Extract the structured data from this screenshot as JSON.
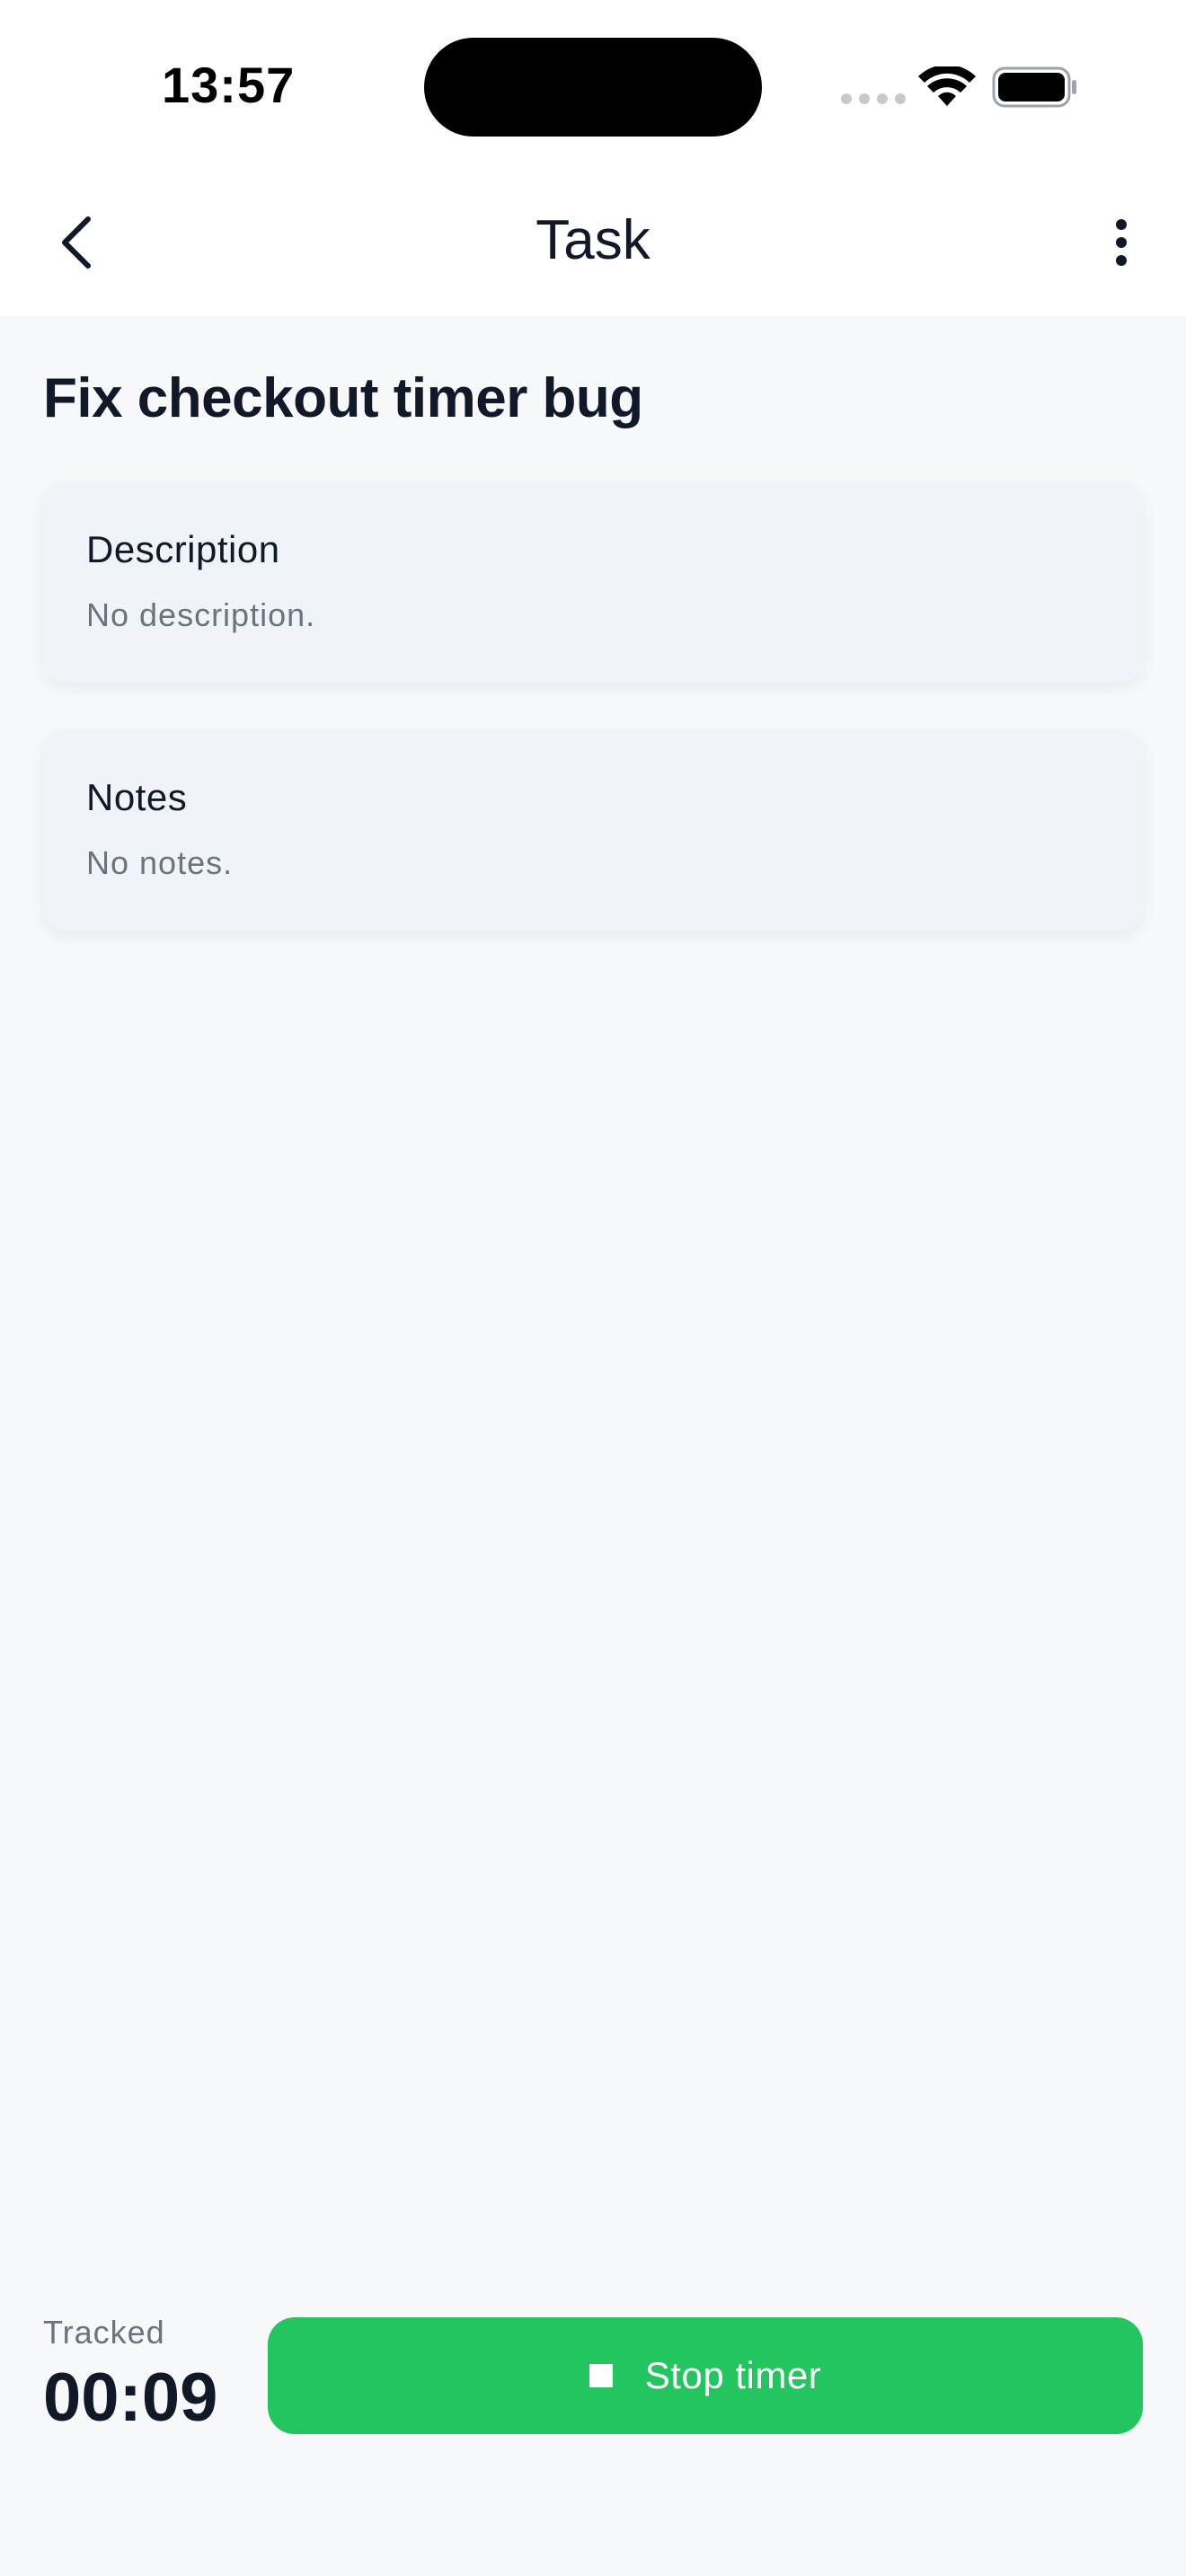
{
  "status_bar": {
    "time": "13:57"
  },
  "nav": {
    "title": "Task"
  },
  "task": {
    "title": "Fix checkout timer bug"
  },
  "cards": {
    "description": {
      "title": "Description",
      "body": "No description."
    },
    "notes": {
      "title": "Notes",
      "body": "No notes."
    }
  },
  "timer": {
    "tracked_label": "Tracked",
    "tracked_value": "00:09",
    "stop_label": "Stop timer"
  },
  "colors": {
    "accent_green": "#22c55e",
    "text_primary": "#111827",
    "text_muted": "#6b7280",
    "card_bg": "#f0f3f7",
    "page_bg": "#f7f8fa"
  },
  "icons": {
    "back": "chevron-left-icon",
    "more": "vertical-ellipsis-icon",
    "stop": "stop-square-icon",
    "wifi": "wifi-icon",
    "battery": "battery-icon",
    "signal": "cellular-signal-icon"
  }
}
